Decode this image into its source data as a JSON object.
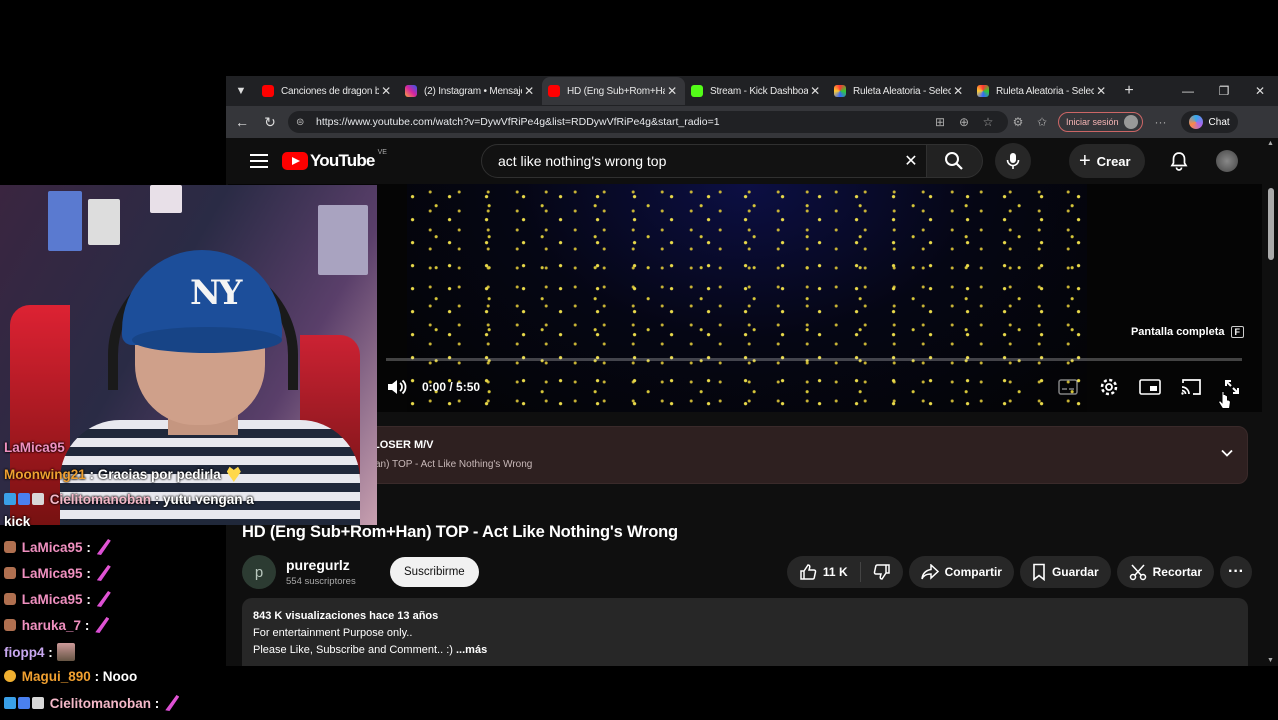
{
  "browser": {
    "tabs": [
      {
        "title": "Canciones de dragon ba",
        "favicon": "youtube",
        "active": false
      },
      {
        "title": "(2) Instagram • Mensaje",
        "favicon": "instagram",
        "active": false
      },
      {
        "title": "HD (Eng Sub+Rom+Han",
        "favicon": "youtube",
        "active": true
      },
      {
        "title": "Stream - Kick Dashboar",
        "favicon": "kick",
        "active": false
      },
      {
        "title": "Ruleta Aleatoria - Selecc",
        "favicon": "ruleta",
        "active": false
      },
      {
        "title": "Ruleta Aleatoria - Selecc",
        "favicon": "ruleta",
        "active": false
      }
    ],
    "url": "https://www.youtube.com/watch?v=DywVfRiPe4g&list=RDDywVfRiPe4g&start_radio=1",
    "signin_label": "Iniciar sesión",
    "chat_label": "Chat"
  },
  "youtube": {
    "logo_text": "YouTube",
    "country_code": "VE",
    "search_query": "act like nothing's wrong top",
    "create_label": "Crear",
    "player": {
      "time": "0:00 / 5:50",
      "progress": 0,
      "fullscreen_tooltip": "Pantalla completa",
      "fullscreen_key": "F"
    },
    "playlist": {
      "title": "LOSER M/V",
      "subtitle": "an) TOP - Act Like Nothing's Wrong"
    },
    "video_title": "HD (Eng Sub+Rom+Han) TOP - Act Like Nothing's Wrong",
    "channel": {
      "avatar_letter": "p",
      "name": "puregurlz",
      "subscribers": "554 suscriptores",
      "subscribe_label": "Suscribirme"
    },
    "actions": {
      "likes": "11 K",
      "share": "Compartir",
      "save": "Guardar",
      "clip": "Recortar"
    },
    "description": {
      "stats": "843 K visualizaciones  hace 13 años",
      "line1": "For entertainment Purpose only..",
      "line2": "Please Like, Subscribe and Comment.. :)",
      "more": "...más"
    }
  },
  "webcam": {
    "cap_logo": "NY"
  },
  "chat": {
    "messages": [
      {
        "user": "LaMica95",
        "text": "",
        "user_color": "#f090c0",
        "emote": "none"
      },
      {
        "user": "Moonwing21",
        "text": ": Gracias por pedirla",
        "user_color": "#f0a030",
        "emote": "heart"
      },
      {
        "user": "Cielitomanoban",
        "text": ": yutu vengan a",
        "user_color": "#f4b8c8",
        "emote": "none",
        "badges": true
      },
      {
        "user": "",
        "text": "kick",
        "user_color": "#ffffff",
        "emote": "none"
      },
      {
        "user": "LaMica95",
        "text": ":",
        "user_color": "#f090c0",
        "emote": "feather",
        "badge": "cat"
      },
      {
        "user": "LaMica95",
        "text": ":",
        "user_color": "#f090c0",
        "emote": "feather",
        "badge": "cat"
      },
      {
        "user": "LaMica95",
        "text": ":",
        "user_color": "#f090c0",
        "emote": "feather",
        "badge": "cat"
      },
      {
        "user": "haruka_7",
        "text": ":",
        "user_color": "#f090c0",
        "emote": "feather",
        "badge": "cat"
      },
      {
        "user": "fiopp4",
        "text": ":",
        "user_color": "#c8a8f0",
        "emote": "photo"
      },
      {
        "user": "Magui_890",
        "text": ": Nooo",
        "user_color": "#f0a030",
        "emote": "none",
        "badge": "star"
      },
      {
        "user": "Cielitomanoban",
        "text": ":",
        "user_color": "#f4b8c8",
        "emote": "feather",
        "badges": true
      }
    ]
  },
  "colors": {
    "yt_red": "#ff0000",
    "yt_bg": "#0f0f0f",
    "chrome_tabbar": "#202124",
    "chrome_toolbar": "#35363a",
    "playlist_bg": "#2e2020"
  }
}
